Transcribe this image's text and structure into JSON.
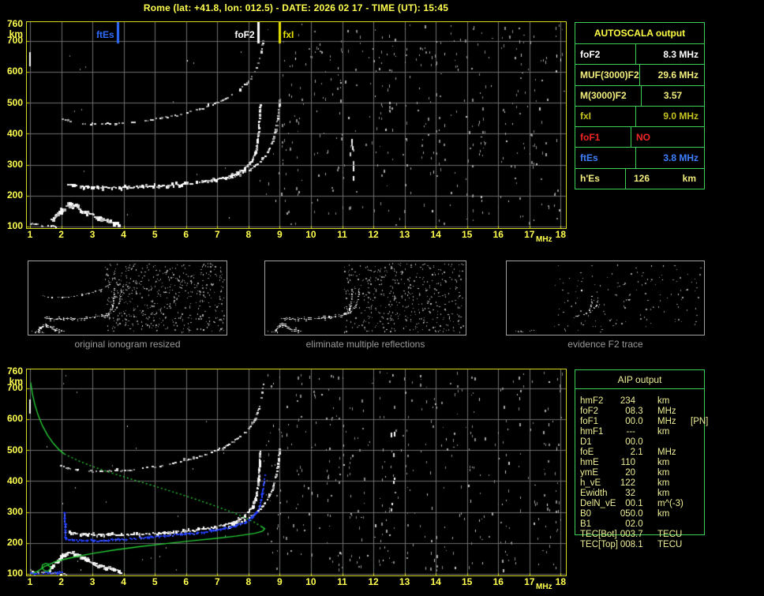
{
  "title": "Rome (lat: +41.8, lon: 012.5) - DATE: 2026 02 17 - TIME (UT): 15:45",
  "colors": {
    "background": "#000000",
    "axis_text": "#ffff4f",
    "plot_border": "#d6d61e",
    "grid": "#6e6e6e",
    "table_border": "#3ed157",
    "caption_text": "#9a9a9a",
    "echo_white": "#ffffff",
    "profile_green": "#25cd36",
    "restored_blue": "#2440ff",
    "marker_ftEs": "#2e6bff",
    "marker_foF2": "#ffffff",
    "marker_fxI": "#e8e400"
  },
  "autoscala_table": {
    "header": "AUTOSCALA output",
    "rows": [
      {
        "label": "foF2",
        "value": "8.3 MHz",
        "color": "#ffffff"
      },
      {
        "label": "MUF(3000)F2",
        "value": "29.6 MHz",
        "color": "#f2ee7e"
      },
      {
        "label": "M(3000)F2",
        "value": "3.57",
        "color": "#f2ee7e"
      },
      {
        "label": "fxI",
        "value": "9.0 MHz",
        "color": "#c6c31e"
      },
      {
        "label": "foF1",
        "value": "NO",
        "color": "#f22525"
      },
      {
        "label": "ftEs",
        "value": "3.8 MHz",
        "color": "#3e7fff"
      },
      {
        "label": "h'Es",
        "value": "126",
        "unit": "km",
        "color": "#f2ee7e"
      }
    ]
  },
  "aip_table": {
    "header": "AIP output",
    "text_color": "#efef96",
    "rows": [
      {
        "label": "hmF2",
        "value": "234",
        "unit": "km",
        "extra": ""
      },
      {
        "label": "foF2",
        "value": "08.3",
        "unit": "MHz",
        "extra": ""
      },
      {
        "label": "foF1",
        "value": "00.0",
        "unit": "MHz",
        "extra": "[PN]"
      },
      {
        "label": "hmF1",
        "value": "---",
        "unit": "km",
        "extra": ""
      },
      {
        "label": "D1",
        "value": "00.0",
        "unit": "",
        "extra": ""
      },
      {
        "label": "foE",
        "value": "2.1",
        "unit": "MHz",
        "extra": ""
      },
      {
        "label": "hmE",
        "value": "110",
        "unit": "km",
        "extra": ""
      },
      {
        "label": "ymE",
        "value": "20",
        "unit": "km",
        "extra": ""
      },
      {
        "label": "h_vE",
        "value": "122",
        "unit": "km",
        "extra": ""
      },
      {
        "label": "Ewidth",
        "value": "32",
        "unit": "km",
        "extra": ""
      },
      {
        "label": "DelN_vE",
        "value": "00.1",
        "unit": "m^(-3)",
        "extra": ""
      },
      {
        "label": "B0",
        "value": "050.0",
        "unit": "km",
        "extra": ""
      },
      {
        "label": "B1",
        "value": "02.0",
        "unit": "",
        "extra": ""
      },
      {
        "label": "TEC[Bot]",
        "value": "003.7",
        "unit": "TECU",
        "extra": ""
      },
      {
        "label": "TEC[Top]",
        "value": "008.1",
        "unit": "TECU",
        "extra": ""
      }
    ]
  },
  "echo_traces": {
    "es_ridge": [
      [
        1.6,
        120
      ],
      [
        1.7,
        128
      ],
      [
        1.78,
        135
      ],
      [
        1.85,
        143
      ],
      [
        1.95,
        152
      ],
      [
        2.05,
        162
      ],
      [
        2.15,
        170
      ],
      [
        2.25,
        174
      ],
      [
        2.35,
        171
      ],
      [
        2.5,
        163
      ],
      [
        2.65,
        154
      ],
      [
        2.8,
        146
      ],
      [
        2.95,
        139
      ],
      [
        3.1,
        132
      ],
      [
        3.25,
        127
      ],
      [
        3.45,
        121
      ],
      [
        3.65,
        115
      ],
      [
        3.85,
        109
      ]
    ],
    "es_low": [
      [
        1.0,
        113
      ],
      [
        1.1,
        110
      ],
      [
        1.22,
        107
      ],
      [
        1.35,
        105
      ],
      [
        1.5,
        107
      ],
      [
        1.65,
        104
      ],
      [
        1.8,
        102
      ],
      [
        1.95,
        101
      ],
      [
        2.15,
        100
      ]
    ],
    "f2_ordinary": [
      [
        2.2,
        240
      ],
      [
        2.45,
        234
      ],
      [
        2.7,
        231
      ],
      [
        3.0,
        229
      ],
      [
        3.3,
        228
      ],
      [
        3.6,
        228
      ],
      [
        3.9,
        228
      ],
      [
        4.2,
        229
      ],
      [
        4.5,
        230
      ],
      [
        4.8,
        231
      ],
      [
        5.1,
        233
      ],
      [
        5.4,
        235
      ],
      [
        5.7,
        237
      ],
      [
        6.0,
        240
      ],
      [
        6.3,
        244
      ],
      [
        6.6,
        248
      ],
      [
        6.9,
        253
      ],
      [
        7.2,
        260
      ],
      [
        7.45,
        268
      ],
      [
        7.65,
        277
      ],
      [
        7.85,
        289
      ],
      [
        8.0,
        303
      ],
      [
        8.1,
        318
      ],
      [
        8.18,
        338
      ],
      [
        8.24,
        362
      ],
      [
        8.28,
        392
      ],
      [
        8.31,
        428
      ],
      [
        8.33,
        465
      ],
      [
        8.35,
        498
      ]
    ],
    "f2_extraordinary": [
      [
        7.35,
        257
      ],
      [
        7.6,
        266
      ],
      [
        7.85,
        277
      ],
      [
        8.05,
        289
      ],
      [
        8.25,
        303
      ],
      [
        8.4,
        318
      ],
      [
        8.55,
        336
      ],
      [
        8.67,
        358
      ],
      [
        8.77,
        384
      ],
      [
        8.85,
        414
      ],
      [
        8.91,
        448
      ],
      [
        8.95,
        482
      ],
      [
        8.98,
        512
      ]
    ],
    "f2_second_hop": [
      [
        1.95,
        452
      ],
      [
        2.2,
        444
      ],
      [
        2.5,
        438
      ],
      [
        2.8,
        435
      ],
      [
        3.1,
        433
      ],
      [
        3.4,
        433
      ],
      [
        3.7,
        434
      ],
      [
        4.0,
        436
      ],
      [
        4.3,
        439
      ],
      [
        4.6,
        443
      ],
      [
        4.9,
        447
      ],
      [
        5.2,
        452
      ],
      [
        5.5,
        458
      ],
      [
        5.8,
        464
      ],
      [
        6.1,
        472
      ],
      [
        6.4,
        481
      ],
      [
        6.7,
        491
      ],
      [
        7.0,
        503
      ],
      [
        7.25,
        515
      ],
      [
        7.5,
        529
      ],
      [
        7.7,
        544
      ],
      [
        7.9,
        562
      ],
      [
        8.05,
        580
      ],
      [
        8.18,
        602
      ],
      [
        8.28,
        628
      ],
      [
        8.36,
        656
      ],
      [
        8.42,
        686
      ],
      [
        8.46,
        712
      ]
    ],
    "edge_bar": [
      [
        1.0,
        615
      ],
      [
        1.0,
        662
      ]
    ],
    "f2_tip": [
      [
        6.9,
        253
      ],
      [
        7.15,
        259
      ],
      [
        7.4,
        266
      ],
      [
        7.6,
        274
      ],
      [
        7.8,
        285
      ],
      [
        7.95,
        298
      ],
      [
        8.08,
        314
      ],
      [
        8.18,
        334
      ],
      [
        8.25,
        358
      ],
      [
        8.29,
        386
      ],
      [
        8.32,
        418
      ],
      [
        8.34,
        450
      ]
    ],
    "f2_x_tip": [
      [
        7.9,
        280
      ],
      [
        8.15,
        295
      ],
      [
        8.35,
        312
      ],
      [
        8.55,
        334
      ],
      [
        8.7,
        362
      ],
      [
        8.82,
        396
      ],
      [
        8.9,
        432
      ]
    ],
    "es_remnant": [
      [
        1.55,
        116
      ],
      [
        1.75,
        112
      ],
      [
        1.95,
        110
      ],
      [
        2.2,
        108
      ],
      [
        2.5,
        106
      ],
      [
        3.0,
        122
      ],
      [
        3.15,
        124
      ]
    ]
  },
  "chart_data": [
    {
      "id": "scaled_ionogram",
      "type": "scatter",
      "xunit": "MHz",
      "yunit": "km",
      "xlim": [
        1,
        18
      ],
      "xticks": [
        1,
        2,
        3,
        4,
        5,
        6,
        7,
        8,
        9,
        10,
        11,
        12,
        13,
        14,
        15,
        16,
        17,
        18
      ],
      "ylim": [
        100,
        760
      ],
      "yticks": [
        760,
        700,
        600,
        500,
        400,
        300,
        200,
        100
      ],
      "grid": true,
      "markers": [
        {
          "label": "ftEs",
          "freq_mhz": 3.8,
          "color": "#2e6bff"
        },
        {
          "label": "foF2",
          "freq_mhz": 8.3,
          "color": "#ffffff"
        },
        {
          "label": "fxI",
          "freq_mhz": 9.0,
          "color": "#e8e400"
        }
      ],
      "echoes": [
        "es_low",
        "es_ridge",
        "f2_ordinary",
        "f2_extraordinary",
        "f2_second_hop",
        "edge_bar"
      ],
      "noise": {
        "seed": 11,
        "columns": [
          9.05,
          9.3,
          9.6,
          10.2,
          10.55,
          10.9,
          11.3,
          11.55,
          12.15,
          12.55,
          13.1,
          13.55,
          13.9,
          14.2,
          14.55,
          15.1,
          15.45,
          16.2,
          16.6,
          17.1,
          17.5,
          17.9
        ],
        "bright_columns": [
          11.3
        ],
        "scatter_dots": 170,
        "sparse_dots": 45
      }
    },
    {
      "id": "restored_ionogram_with_profile",
      "type": "scatter",
      "xunit": "MHz",
      "yunit": "km",
      "xlim": [
        1,
        18
      ],
      "xticks": [
        1,
        2,
        3,
        4,
        5,
        6,
        7,
        8,
        9,
        10,
        11,
        12,
        13,
        14,
        15,
        16,
        17,
        18
      ],
      "ylim": [
        100,
        760
      ],
      "yticks": [
        760,
        700,
        600,
        500,
        400,
        300,
        200,
        100
      ],
      "grid": true,
      "markers": [],
      "echoes": [
        "es_low",
        "es_ridge",
        "f2_ordinary",
        "f2_extraordinary",
        "f2_second_hop",
        "edge_bar"
      ],
      "noise": {
        "seed": 23,
        "columns": [
          9.0,
          9.3,
          9.65,
          10.2,
          10.6,
          11.0,
          11.35,
          11.6,
          12.3,
          12.6,
          13.15,
          13.6,
          13.95,
          14.25,
          14.6,
          15.15,
          15.5,
          16.25,
          16.65,
          17.15,
          17.55,
          17.95
        ],
        "bright_columns": [
          12.6
        ],
        "scatter_dots": 180,
        "sparse_dots": 45
      },
      "profile": {
        "name": "electron density profile",
        "color": "#25cd36",
        "solid_upper": [
          [
            1.02,
            718
          ],
          [
            1.08,
            680
          ],
          [
            1.16,
            645
          ],
          [
            1.27,
            610
          ],
          [
            1.4,
            578
          ],
          [
            1.56,
            548
          ],
          [
            1.75,
            521
          ],
          [
            1.95,
            499
          ],
          [
            2.1,
            487
          ]
        ],
        "dotted_mid": [
          [
            2.1,
            487
          ],
          [
            2.6,
            463
          ],
          [
            3.1,
            443
          ],
          [
            3.7,
            423
          ],
          [
            4.3,
            404
          ],
          [
            5.0,
            383
          ],
          [
            5.7,
            361
          ],
          [
            6.4,
            338
          ],
          [
            7.0,
            317
          ],
          [
            7.5,
            298
          ],
          [
            7.9,
            281
          ],
          [
            8.2,
            266
          ],
          [
            8.4,
            254
          ]
        ],
        "solid_lower": [
          [
            8.4,
            254
          ],
          [
            8.52,
            246
          ],
          [
            8.45,
            238
          ],
          [
            8.2,
            231
          ],
          [
            7.6,
            222
          ],
          [
            6.9,
            214
          ],
          [
            6.1,
            206
          ],
          [
            5.3,
            197
          ],
          [
            4.5,
            188
          ],
          [
            3.7,
            177
          ],
          [
            3.0,
            166
          ],
          [
            2.5,
            156
          ],
          [
            2.1,
            147
          ],
          [
            1.8,
            139
          ],
          [
            1.62,
            131
          ]
        ],
        "loop": [
          [
            1.62,
            131
          ],
          [
            1.5,
            134
          ],
          [
            1.4,
            129
          ],
          [
            1.38,
            120
          ],
          [
            1.44,
            112
          ],
          [
            1.55,
            108
          ],
          [
            1.64,
            113
          ],
          [
            1.66,
            122
          ],
          [
            1.58,
            128
          ],
          [
            1.48,
            125
          ],
          [
            1.36,
            116
          ],
          [
            1.22,
            107
          ],
          [
            1.1,
            102
          ],
          [
            1.02,
            100
          ]
        ]
      },
      "restored": {
        "name": "restored F2 trace",
        "color": "#2440ff",
        "vertical": [
          [
            2.08,
            300
          ],
          [
            2.08,
            288
          ],
          [
            2.09,
            276
          ],
          [
            2.1,
            264
          ],
          [
            2.1,
            252
          ],
          [
            2.11,
            240
          ],
          [
            2.12,
            228
          ],
          [
            2.13,
            216
          ]
        ],
        "main": [
          [
            2.15,
            214
          ],
          [
            2.4,
            211
          ],
          [
            2.7,
            209
          ],
          [
            3.0,
            209
          ],
          [
            3.4,
            211
          ],
          [
            3.8,
            213
          ],
          [
            4.3,
            216
          ],
          [
            4.8,
            220
          ],
          [
            5.3,
            224
          ],
          [
            5.8,
            229
          ],
          [
            6.3,
            234
          ],
          [
            6.8,
            241
          ],
          [
            7.2,
            248
          ],
          [
            7.6,
            258
          ],
          [
            7.9,
            270
          ],
          [
            8.1,
            284
          ],
          [
            8.25,
            302
          ],
          [
            8.35,
            326
          ],
          [
            8.42,
            356
          ],
          [
            8.47,
            390
          ],
          [
            8.5,
            420
          ]
        ],
        "es": [
          [
            1.0,
            103
          ],
          [
            1.12,
            103
          ],
          [
            1.25,
            104
          ],
          [
            1.4,
            104
          ],
          [
            1.55,
            105
          ],
          [
            1.7,
            105
          ],
          [
            1.85,
            106
          ],
          [
            2.0,
            107
          ]
        ]
      }
    },
    {
      "id": "thumb_original",
      "type": "scatter",
      "caption": "original ionogram resized",
      "echoes": [
        "es_low",
        "es_ridge",
        "f2_ordinary",
        "f2_extraordinary",
        "f2_second_hop"
      ],
      "noise": {
        "seed": 31,
        "scatter_dots": 540,
        "x_min_mhz": 7.6
      }
    },
    {
      "id": "thumb_filtered",
      "type": "scatter",
      "caption": "eliminate multiple reflections",
      "echoes": [
        "es_low",
        "es_ridge",
        "f2_ordinary",
        "f2_extraordinary"
      ],
      "noise": {
        "seed": 37,
        "scatter_dots": 470,
        "x_min_mhz": 7.6
      }
    },
    {
      "id": "thumb_f2",
      "type": "scatter",
      "caption": "evidence F2 trace",
      "echoes": [
        "f2_tip",
        "f2_x_tip",
        "es_remnant"
      ],
      "noise": {
        "seed": 41,
        "scatter_dots": 150,
        "x_min_mhz": 5.0
      }
    }
  ]
}
